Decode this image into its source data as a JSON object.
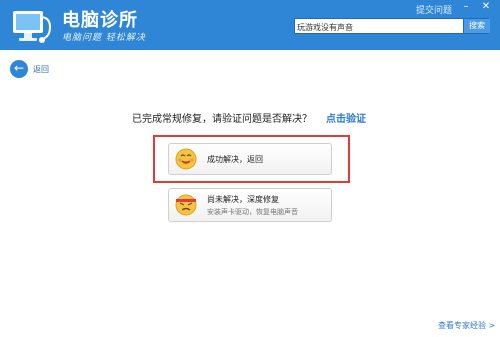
{
  "header": {
    "title": "电脑诊所",
    "subtitle": "电脑问题 轻松解决",
    "submit_link": "提交问题",
    "search": {
      "value": "玩游戏没有声音",
      "button": "搜索"
    }
  },
  "nav": {
    "back_label": "返回"
  },
  "main": {
    "question": "已完成常规修复，请验证问题是否解决？",
    "verify_link": "点击验证",
    "options": [
      {
        "title": "成功解决，返回",
        "subtitle": ""
      },
      {
        "title": "尚未解决，深度修复",
        "subtitle": "安装声卡驱动，恢复电脑声音"
      }
    ]
  },
  "footer": {
    "link": "查看专家经验 >"
  },
  "colors": {
    "header": "#2f86d6",
    "accent": "#2c7bd3",
    "highlight": "#e03b3b"
  }
}
